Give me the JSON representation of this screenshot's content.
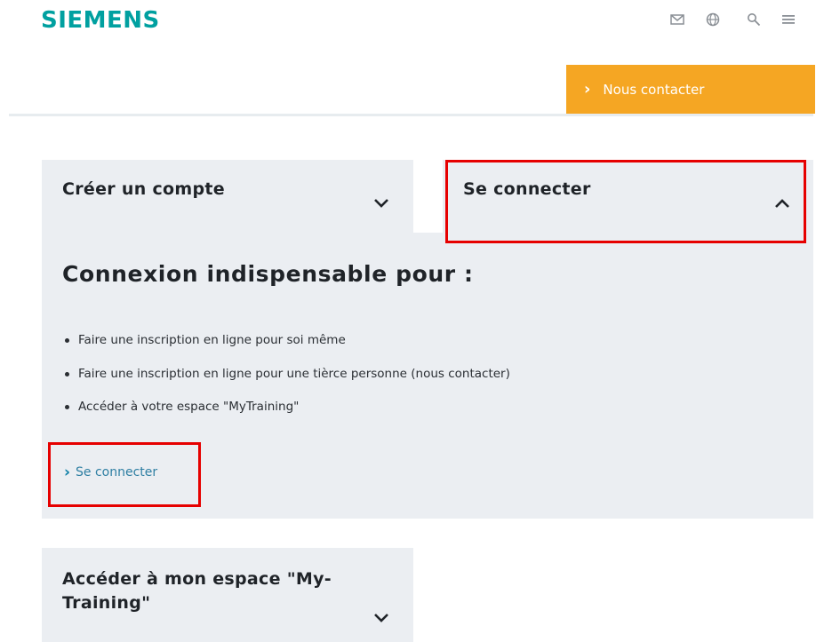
{
  "header": {
    "logo": "SIEMENS",
    "icons": [
      "mail-icon",
      "globe-icon",
      "search-icon",
      "menu-icon"
    ],
    "contact_button": "Nous contacter",
    "accent_color": "#f5a623",
    "brand_color": "#00a0a0"
  },
  "accordion": {
    "create_account": {
      "label": "Créer un compte",
      "expanded": false
    },
    "login": {
      "label": "Se connecter",
      "expanded": true
    },
    "my_training": {
      "label": "Accéder à mon espace \"My-Training\"",
      "label_line1": "Accéder à mon espace \"My-",
      "label_line2": "Training\"",
      "expanded": false
    }
  },
  "panel": {
    "title": "Connexion indispensable pour :",
    "bullets": [
      "Faire une inscription en ligne pour soi même",
      "Faire une inscription en ligne pour une tièrce personne (nous contacter)",
      "Accéder à votre espace \"MyTraining\""
    ],
    "login_link": "Se connecter"
  },
  "annotations": {
    "highlight_color": "#e60000"
  }
}
